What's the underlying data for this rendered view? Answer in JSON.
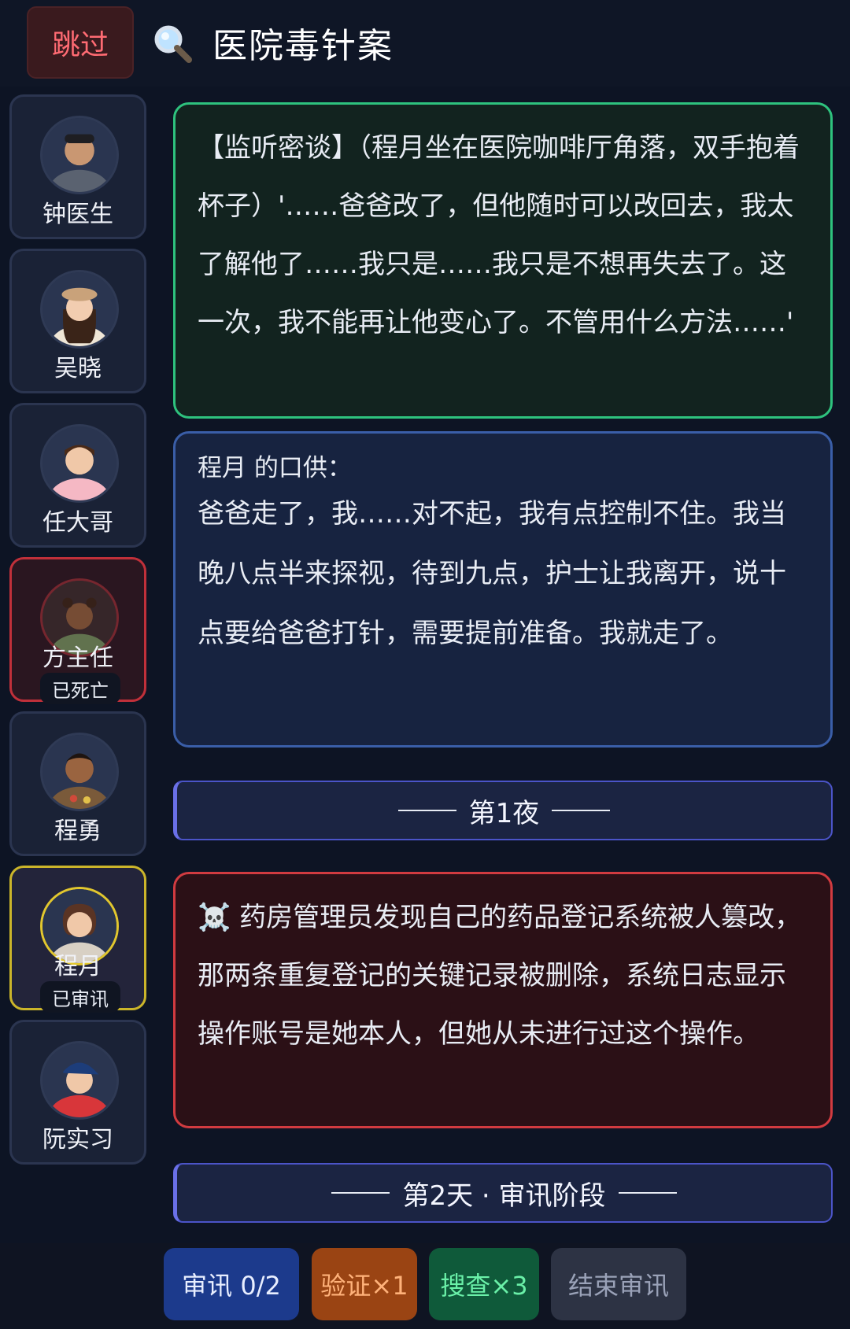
{
  "header": {
    "skip_label": "跳过",
    "title": "医院毒针案"
  },
  "sidebar": {
    "characters": [
      {
        "name": "钟医生",
        "status": ""
      },
      {
        "name": "吴晓",
        "status": ""
      },
      {
        "name": "任大哥",
        "status": ""
      },
      {
        "name": "方主任",
        "status": "已死亡"
      },
      {
        "name": "程勇",
        "status": ""
      },
      {
        "name": "程月",
        "status": "已审讯"
      },
      {
        "name": "阮实习",
        "status": ""
      }
    ]
  },
  "feed": {
    "eavesdrop": "【监听密谈】（程月坐在医院咖啡厅角落，双手抱着杯子）'……爸爸改了，但他随时可以改回去，我太了解他了……我只是……我只是不想再失去了。这一次，我不能再让他变心了。不管用什么方法……'",
    "testimony_speaker": "程月 的口供：",
    "testimony_text": "爸爸走了，我……对不起，我有点控制不住。我当晚八点半来探视，待到九点，护士让我离开，说十点要给爸爸打针，需要提前准备。我就走了。",
    "night_divider": "第1夜",
    "event_icon": "☠️",
    "event_text": "药房管理员发现自己的药品登记系统被人篡改，那两条重复登记的关键记录被删除，系统日志显示操作账号是她本人，但她从未进行过这个操作。",
    "day_divider": "第2天 · 审讯阶段"
  },
  "actions": {
    "interrogate": "审讯 0/2",
    "verify": "验证×1",
    "search": "搜查×3",
    "end": "结束审讯"
  }
}
